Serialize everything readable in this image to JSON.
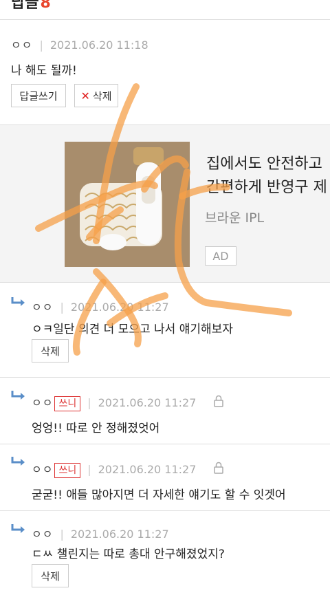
{
  "section": {
    "title": "답글",
    "count": "8"
  },
  "comments": [
    {
      "nick": "ㅇㅇ",
      "date": "2021.06.20 11:18",
      "text": "나 해도 될까!",
      "reply_label": "답글쓰기",
      "delete_label": "삭제"
    }
  ],
  "ad": {
    "title_line1": "집에서도 안전하고",
    "title_line2": "간편하게 반영구 제",
    "brand": "브라운 IPL",
    "badge": "AD"
  },
  "replies": [
    {
      "nick": "ㅇㅇ",
      "date": "2021.06.20 11:27",
      "text": "ㅇㅋ일단 의견 더 모으고 나서 얘기해보자",
      "delete_label": "삭제"
    },
    {
      "nick": "ㅇㅇ",
      "tag": "쓰니",
      "date": "2021.06.20 11:27",
      "text": "엉엉!! 따로 안 정해졌엇어"
    },
    {
      "nick": "ㅇㅇ",
      "tag": "쓰니",
      "date": "2021.06.20 11:27",
      "text": "굳굳!! 애들 많아지면 더 자세한 얘기도 할 수 잇겟어"
    },
    {
      "nick": "ㅇㅇ",
      "date": "2021.06.20 11:27",
      "text": "ㄷㅆ 챌린지는 따로 총대 안구해졌었지?",
      "delete_label": "삭제"
    }
  ]
}
